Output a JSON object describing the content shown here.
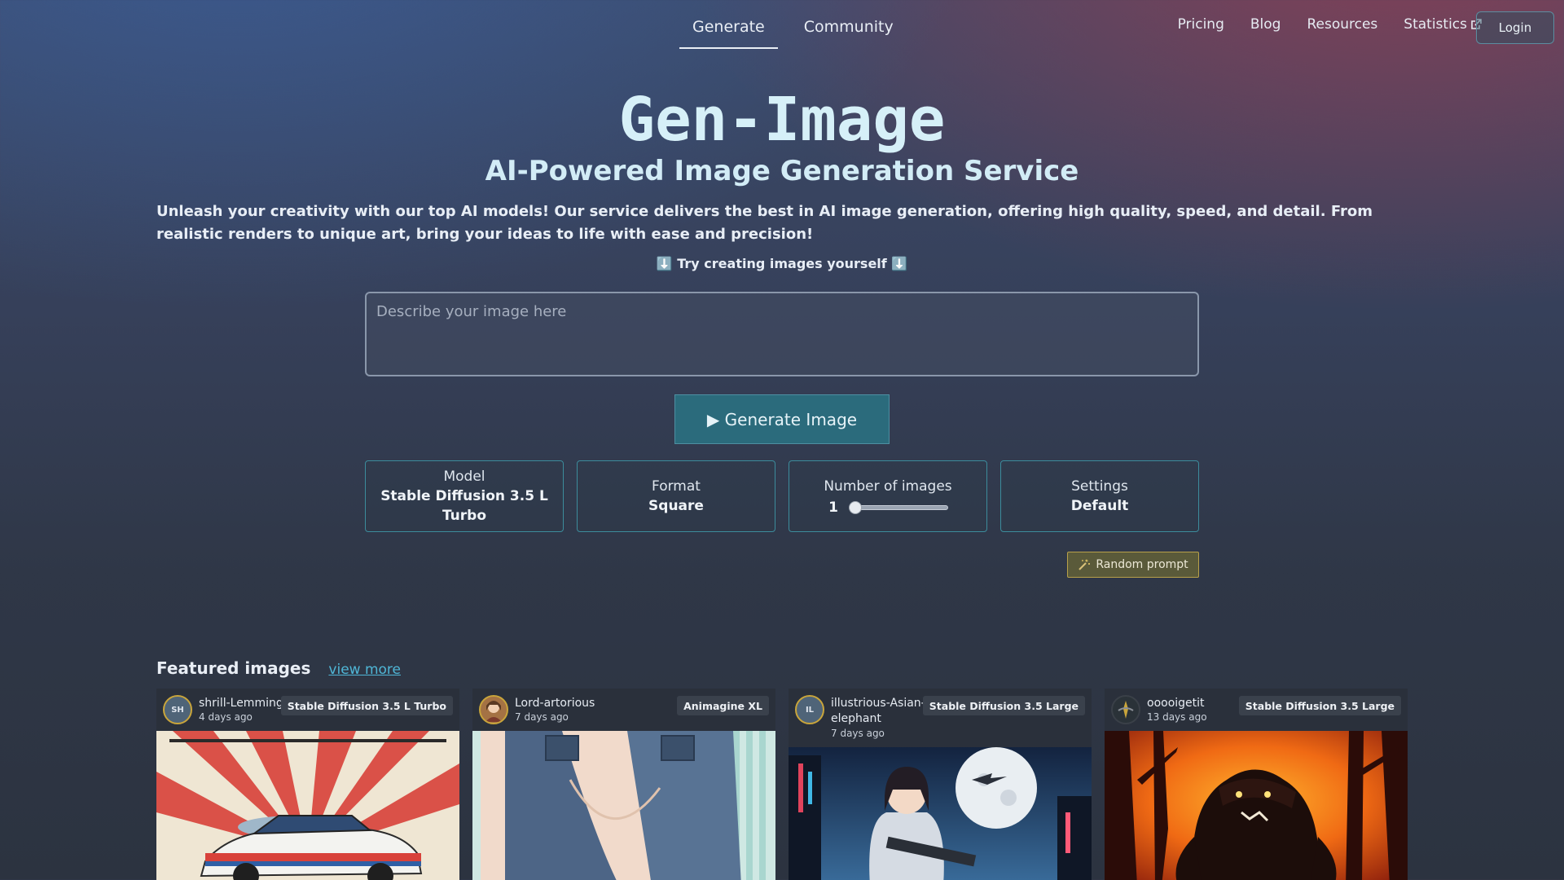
{
  "nav": {
    "tabs": [
      {
        "label": "Generate",
        "active": true
      },
      {
        "label": "Community",
        "active": false
      }
    ],
    "links": [
      "Pricing",
      "Blog",
      "Resources",
      "Statistics"
    ],
    "login_label": "Login"
  },
  "hero": {
    "title": "Gen-Image",
    "subtitle": "AI-Powered Image Generation Service",
    "description": "Unleash your creativity with our top AI models! Our service delivers the best in AI image generation, offering high quality, speed, and detail. From realistic renders to unique art, bring your ideas to life with ease and precision!",
    "try_line": "⬇️ Try creating images yourself ⬇️"
  },
  "prompt": {
    "placeholder": "Describe your image here",
    "value": ""
  },
  "generate": {
    "icon": "play-icon",
    "label": "▶ Generate Image"
  },
  "options": {
    "model": {
      "label": "Model",
      "value": "Stable Diffusion 3.5 L Turbo"
    },
    "format": {
      "label": "Format",
      "value": "Square"
    },
    "number": {
      "label": "Number of images",
      "value": "1",
      "min": 1,
      "max": 8
    },
    "settings": {
      "label": "Settings",
      "value": "Default"
    }
  },
  "random_prompt": {
    "icon": "magic-wand-icon",
    "label": "Random prompt"
  },
  "featured": {
    "title": "Featured images",
    "view_more": "view more",
    "cards": [
      {
        "initials": "SH",
        "user": "shrill-Lemming",
        "time": "4 days ago",
        "model": "Stable Diffusion 3.5 L Turbo",
        "image": "race-car-rising-sun-image"
      },
      {
        "initials": "",
        "user": "Lord-artorious",
        "time": "7 days ago",
        "model": "Animagine XL",
        "image": "anime-overalls-image"
      },
      {
        "initials": "IL",
        "user": "illustrious-Asian-elephant",
        "time": "7 days ago",
        "model": "Stable Diffusion 3.5 Large",
        "image": "sci-fi-soldier-moon-image"
      },
      {
        "initials": "",
        "user": "ooooigetit",
        "time": "13 days ago",
        "model": "Stable Diffusion 3.5 Large",
        "image": "monster-forest-fire-image"
      }
    ]
  },
  "colors": {
    "accent": "#2b6b7c",
    "link": "#4fb6d6",
    "option_border": "#3c8c9c",
    "random_border": "#b8a14a"
  }
}
